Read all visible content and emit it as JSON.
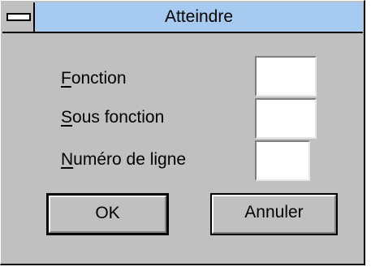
{
  "window": {
    "title": "Atteindre"
  },
  "form": {
    "fonction": {
      "access_key": "F",
      "rest": "onction",
      "value": ""
    },
    "sous_fonction": {
      "access_key": "S",
      "rest": "ous fonction",
      "value": ""
    },
    "numero_ligne": {
      "access_key": "N",
      "rest": "uméro de ligne",
      "value": ""
    }
  },
  "buttons": {
    "ok_label": "OK",
    "cancel_label": "Annuler"
  }
}
